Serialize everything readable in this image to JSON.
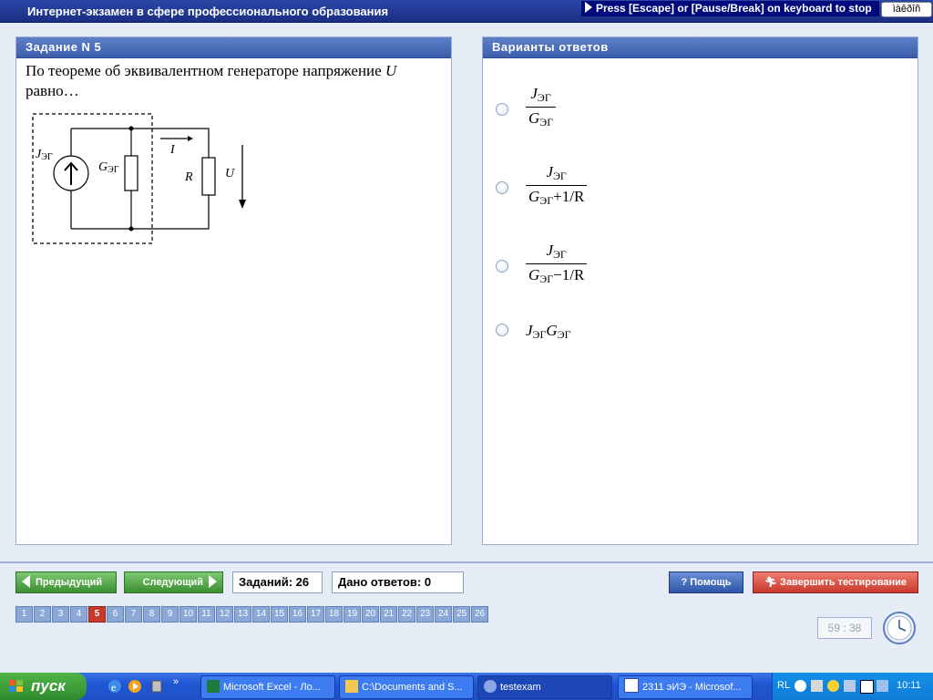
{
  "window": {
    "title": "Интернет-экзамен в сфере профессионального образования",
    "escape_notice": "Press [Escape] or [Pause/Break] on keyboard to stop",
    "lang_box": "ìàêðîñ"
  },
  "question": {
    "header": "Задание N 5",
    "text_before": "По теореме об эквивалентном генераторе напряжение ",
    "variable": "U",
    "text_after": "равно…",
    "circuit_labels": {
      "source": "J",
      "source_sub": "ЭГ",
      "conductance": "G",
      "conductance_sub": "ЭГ",
      "current": "I",
      "resistor": "R",
      "voltage": "U"
    }
  },
  "answers": {
    "header": "Варианты ответов",
    "items": [
      {
        "num": "J",
        "num_sub": "ЭГ",
        "den": "G",
        "den_sub": "ЭГ",
        "den_tail": ""
      },
      {
        "num": "J",
        "num_sub": "ЭГ",
        "den": "G",
        "den_sub": "ЭГ",
        "den_tail": "+1/R"
      },
      {
        "num": "J",
        "num_sub": "ЭГ",
        "den": "G",
        "den_sub": "ЭГ",
        "den_tail": "−1/R"
      },
      {
        "a": "J",
        "a_sub": "ЭГ",
        "b": "G",
        "b_sub": "ЭГ"
      }
    ]
  },
  "nav": {
    "prev_label": "Предыдущий",
    "next_label": "Следующий",
    "tasks_count": "Заданий: 26",
    "answers_given": "Дано ответов: 0",
    "help_label": "Помощь",
    "finish_label": "Завершить тестирование",
    "pages": [
      "1",
      "2",
      "3",
      "4",
      "5",
      "6",
      "7",
      "8",
      "9",
      "10",
      "11",
      "12",
      "13",
      "14",
      "15",
      "16",
      "17",
      "18",
      "19",
      "20",
      "21",
      "22",
      "23",
      "24",
      "25",
      "26"
    ],
    "current_page": "5",
    "timer": "59 : 38"
  },
  "taskbar": {
    "start_label": "пуск",
    "tasks": [
      "Microsoft Excel - Ло...",
      "C:\\Documents and S...",
      "testexam",
      "2311 эИЭ - Microsof..."
    ],
    "tray_lang": "RL",
    "clock": "10:11"
  },
  "colors": {
    "panel_header": "#3d5eab",
    "current_page": "#c9382c",
    "nav_green": "#3a8e30",
    "finish_red": "#c83a2e",
    "taskbar_blue": "#2157d4"
  }
}
